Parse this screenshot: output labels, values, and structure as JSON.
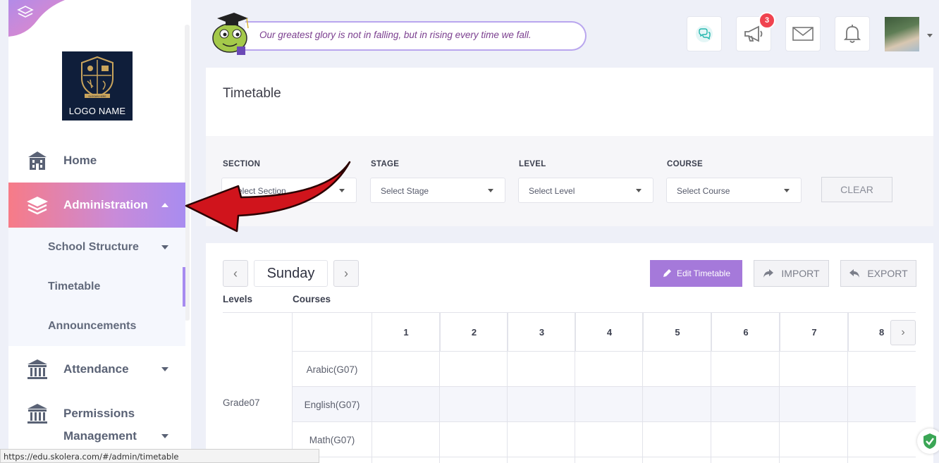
{
  "sidebar": {
    "logo_text": "LOGO NAME",
    "logo_seal_text": "SLOGAN HERE",
    "items": [
      {
        "label": "Home",
        "icon": "building-icon"
      },
      {
        "label": "Administration",
        "icon": "layers-icon"
      },
      {
        "label": "Attendance",
        "icon": "institution-icon"
      },
      {
        "label": "Permissions",
        "label2": "Management",
        "icon": "institution-icon"
      }
    ],
    "submenu": [
      "School Structure",
      "Timetable",
      "Announcements"
    ]
  },
  "header": {
    "quote": "Our greatest glory is not in falling, but in rising every time we fall.",
    "notifications_badge": "3"
  },
  "timetable": {
    "title": "Timetable",
    "filters": [
      {
        "label": "SECTION",
        "placeholder": "Select Section"
      },
      {
        "label": "STAGE",
        "placeholder": "Select Stage"
      },
      {
        "label": "LEVEL",
        "placeholder": "Select Level"
      },
      {
        "label": "COURSE",
        "placeholder": "Select Course"
      }
    ],
    "clear_label": "CLEAR",
    "day": "Sunday",
    "edit_label": "Edit Timetable",
    "import_label": "IMPORT",
    "export_label": "EXPORT",
    "levels_header": "Levels",
    "courses_header": "Courses",
    "periods": [
      "1",
      "2",
      "3",
      "4",
      "5",
      "6",
      "7",
      "8"
    ],
    "level": "Grade07",
    "courses": [
      "Arabic(G07)",
      "English(G07)",
      "Math(G07)"
    ]
  },
  "status_url": "https://edu.skolera.com/#/admin/timetable",
  "colors": {
    "accent": "#a579da",
    "active_gradient_start": "#f77b87",
    "active_gradient_end": "#a88cf0",
    "badge": "#f0434f",
    "annotation_arrow": "#d0141c"
  }
}
